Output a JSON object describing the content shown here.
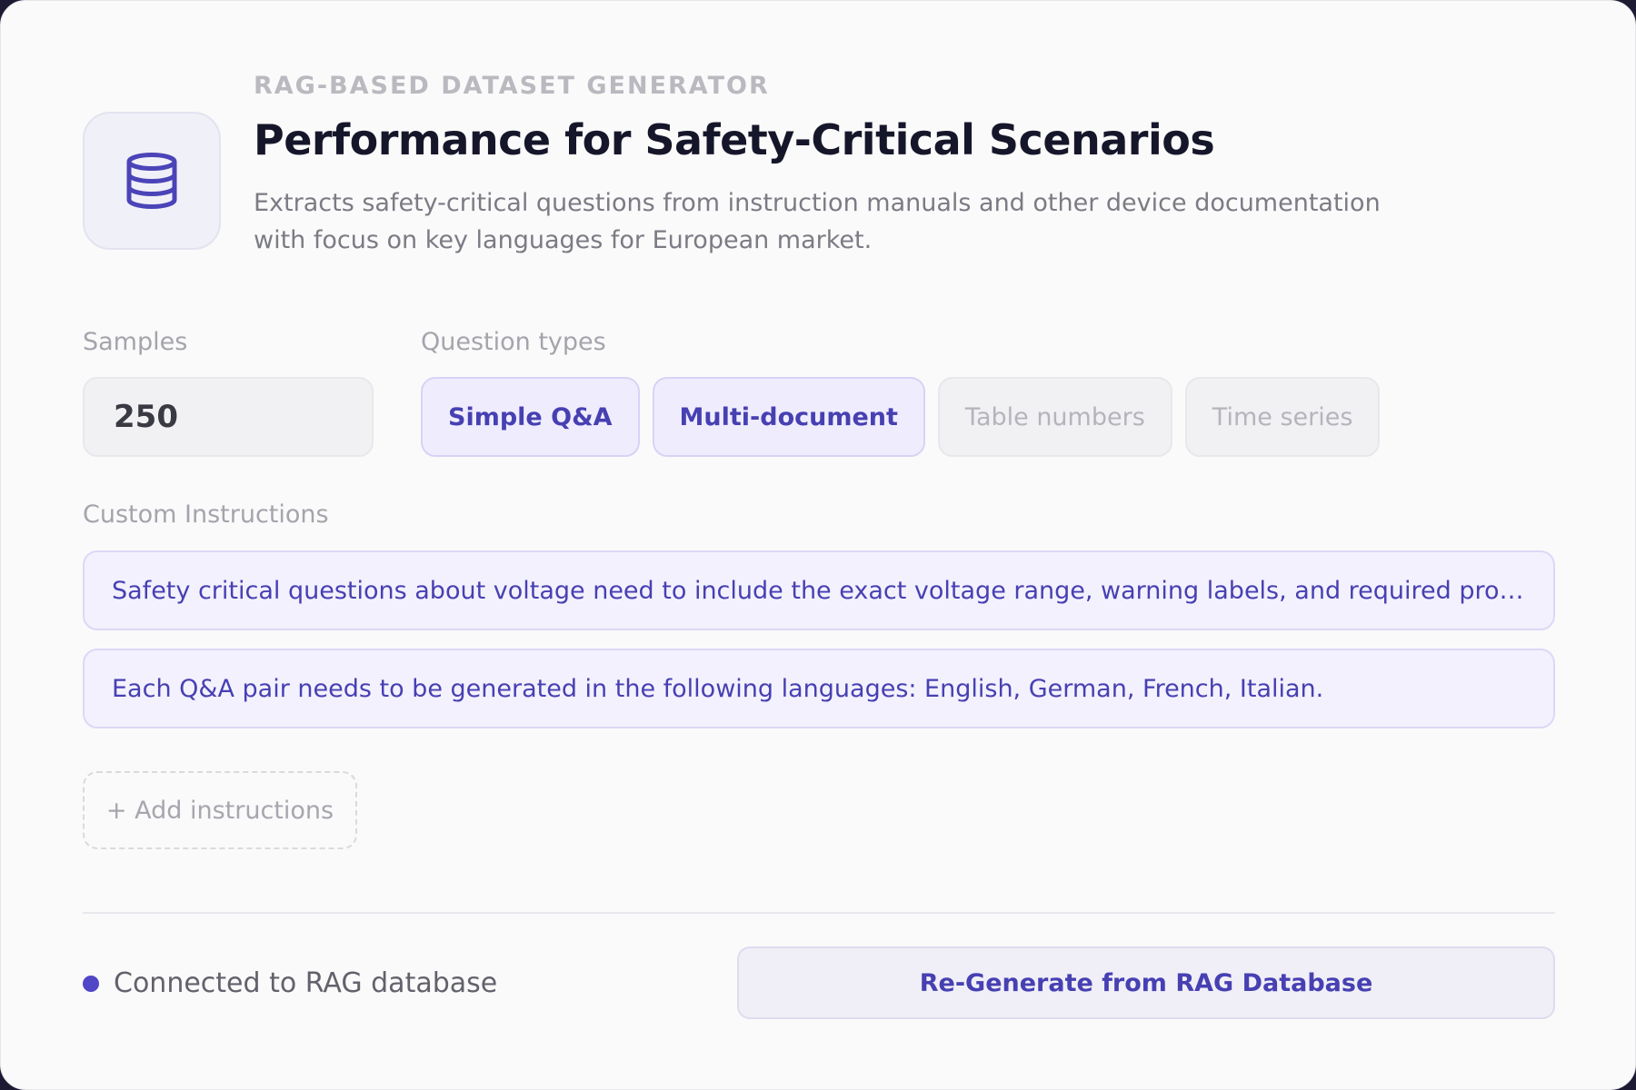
{
  "header": {
    "eyebrow": "RAG-BASED DATASET GENERATOR",
    "title": "Performance for Safety-Critical Scenarios",
    "description": "Extracts safety-critical questions from instruction manuals and other device documentation with focus on key languages for European market.",
    "icon": "database-icon"
  },
  "samples": {
    "label": "Samples",
    "value": "250"
  },
  "question_types": {
    "label": "Question types",
    "chips": [
      {
        "label": "Simple Q&A",
        "selected": true
      },
      {
        "label": "Multi-document",
        "selected": true
      },
      {
        "label": "Table numbers",
        "selected": false
      },
      {
        "label": "Time series",
        "selected": false
      }
    ]
  },
  "custom_instructions": {
    "label": "Custom Instructions",
    "items": [
      "Safety critical questions about voltage need to include the exact voltage range, warning labels, and required protective...",
      "Each Q&A pair needs to be generated in the following languages: English, German, French, Italian."
    ],
    "add_label": "+ Add instructions"
  },
  "footer": {
    "status": "Connected to RAG database",
    "regenerate_label": "Re-Generate from RAG Database"
  },
  "colors": {
    "accent": "#4740b2",
    "status_dot": "#5146c6"
  }
}
